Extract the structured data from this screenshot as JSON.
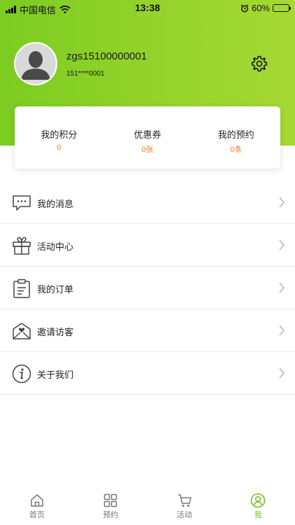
{
  "status_bar": {
    "carrier": "中国电信",
    "time": "13:38",
    "battery": "60%",
    "battery_level": 0.6
  },
  "profile": {
    "username": "zgs15100000001",
    "phone": "151****0001"
  },
  "stats": [
    {
      "label": "我的积分",
      "value": "0"
    },
    {
      "label": "优惠券",
      "value": "0张"
    },
    {
      "label": "我的预约",
      "value": "0条"
    }
  ],
  "menu": [
    {
      "label": "我的消息",
      "icon": "message-icon"
    },
    {
      "label": "活动中心",
      "icon": "gift-icon"
    },
    {
      "label": "我的订单",
      "icon": "clipboard-icon"
    },
    {
      "label": "邀请访客",
      "icon": "invite-envelope-icon"
    },
    {
      "label": "关于我们",
      "icon": "info-icon"
    }
  ],
  "tabs": [
    {
      "label": "首页",
      "icon": "home-icon",
      "active": false
    },
    {
      "label": "预约",
      "icon": "grid-icon",
      "active": false
    },
    {
      "label": "活动",
      "icon": "cart-icon",
      "active": false
    },
    {
      "label": "我",
      "icon": "user-circle-icon",
      "active": true
    }
  ],
  "colors": {
    "header_green": "#8ccf25",
    "accent_orange": "#ec7f2e",
    "active_tab": "#76c11d"
  }
}
